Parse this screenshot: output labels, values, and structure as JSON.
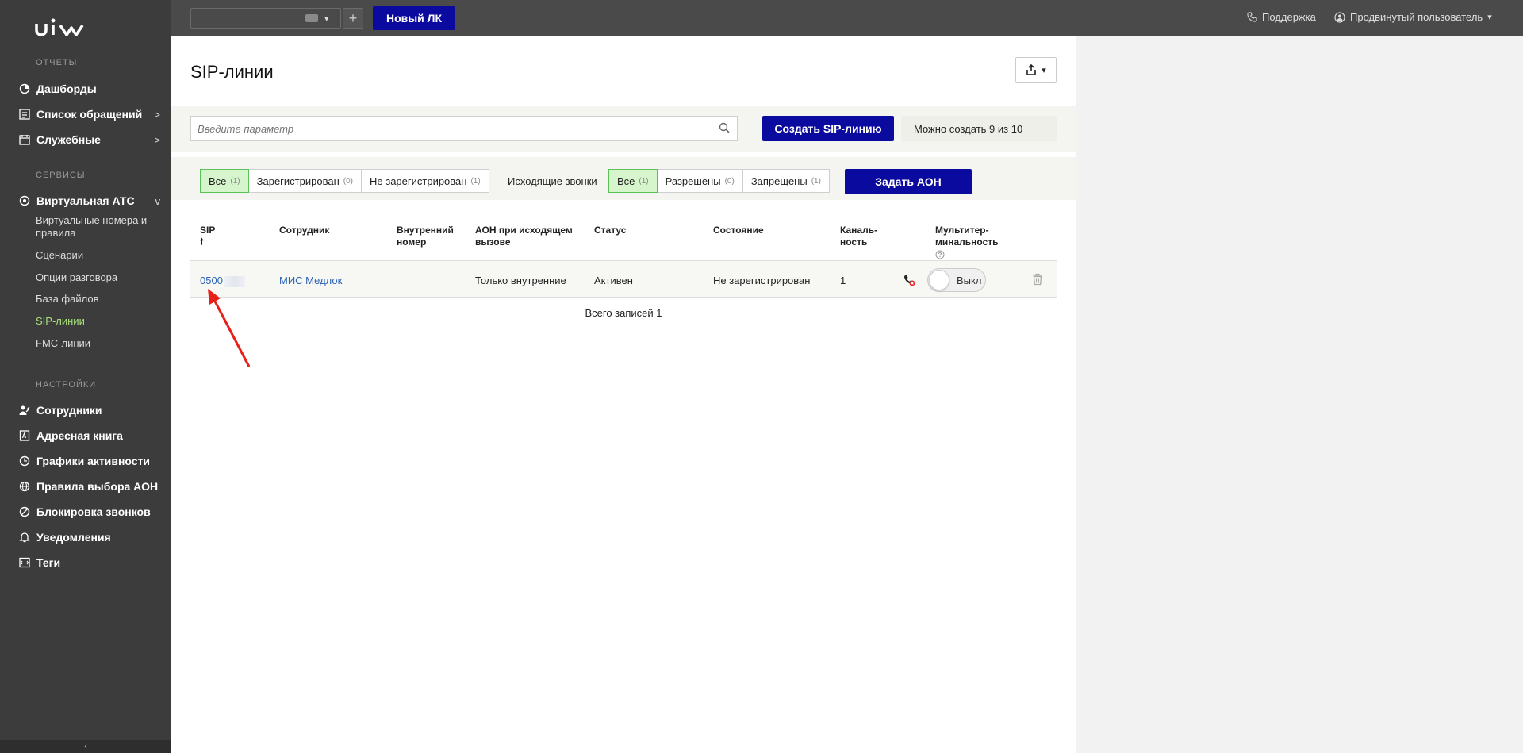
{
  "sidebar": {
    "logo_text": "uis",
    "sections": {
      "reports": "ОТЧЕТЫ",
      "services": "СЕРВИСЫ",
      "settings": "НАСТРОЙКИ"
    },
    "reports_items": [
      {
        "label": "Дашборды",
        "icon": "dashboard-icon",
        "arrow": ""
      },
      {
        "label": "Список обращений",
        "icon": "list-icon",
        "arrow": ">"
      },
      {
        "label": "Служебные",
        "icon": "calendar-icon",
        "arrow": ">"
      }
    ],
    "vats": {
      "label": "Виртуальная АТС",
      "icon": "pbx-icon",
      "arrow": "v"
    },
    "vats_sub": [
      {
        "label": "Виртуальные номера и правила"
      },
      {
        "label": "Сценарии"
      },
      {
        "label": "Опции разговора"
      },
      {
        "label": "База файлов"
      },
      {
        "label": "SIP-линии"
      },
      {
        "label": "FMC-линии"
      }
    ],
    "settings_items": [
      {
        "label": "Сотрудники",
        "icon": "employees-icon"
      },
      {
        "label": "Адресная книга",
        "icon": "address-book-icon"
      },
      {
        "label": "Графики активности",
        "icon": "clock-icon"
      },
      {
        "label": "Правила выбора АОН",
        "icon": "globe-icon"
      },
      {
        "label": "Блокировка звонков",
        "icon": "block-icon"
      },
      {
        "label": "Уведомления",
        "icon": "bell-icon"
      },
      {
        "label": "Теги",
        "icon": "tag-icon"
      }
    ],
    "collapse_symbol": "‹"
  },
  "topbar": {
    "new_lk": "Новый ЛК",
    "support": "Поддержка",
    "user": "Продвинутый пользователь"
  },
  "page": {
    "title": "SIP-линии",
    "search_placeholder": "Введите параметр",
    "create_button": "Создать SIP-линию",
    "can_create": "Можно создать 9 из 10",
    "reg_filter": [
      {
        "label": "Все",
        "count": "(1)"
      },
      {
        "label": "Зарегистрирован",
        "count": "(0)"
      },
      {
        "label": "Не зарегистрирован",
        "count": "(1)"
      }
    ],
    "outgoing_label": "Исходящие звонки",
    "out_filter": [
      {
        "label": "Все",
        "count": "(1)"
      },
      {
        "label": "Разрешены",
        "count": "(0)"
      },
      {
        "label": "Запрещены",
        "count": "(1)"
      }
    ],
    "aon_button": "Задать АОН"
  },
  "table": {
    "headers": {
      "sip": "SIP",
      "sort_arrow": "🠕",
      "employee": "Сотрудник",
      "internal": "Внутренний номер",
      "aon": "АОН при исходящем вызове",
      "status": "Статус",
      "state": "Состояние",
      "channels": "Каналь-ность",
      "multiterm": "Мультитер-минальность"
    },
    "row": {
      "sip": "0500",
      "employee": "МИС Медлок",
      "internal": "",
      "aon": "Только внутренние",
      "status": "Активен",
      "state": "Не зарегистрирован",
      "channels": "1",
      "toggle": "Выкл"
    },
    "total": "Всего записей 1"
  }
}
